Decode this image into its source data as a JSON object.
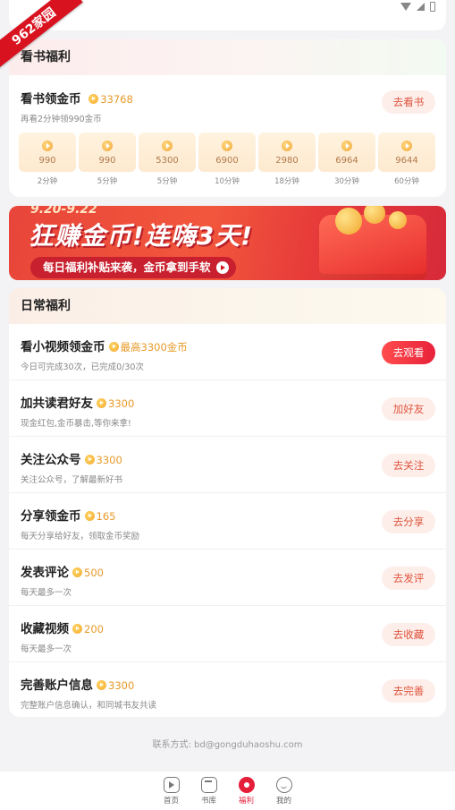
{
  "ribbon_text": "962家园",
  "reading": {
    "header": "看书福利",
    "task_title": "看书领金币",
    "reward": "33768",
    "desc": "再看2分钟领990金币",
    "button": "去看书",
    "slots": [
      {
        "amount": "990",
        "time": "2分钟"
      },
      {
        "amount": "990",
        "time": "5分钟"
      },
      {
        "amount": "5300",
        "time": "5分钟"
      },
      {
        "amount": "6900",
        "time": "10分钟"
      },
      {
        "amount": "2980",
        "time": "18分钟"
      },
      {
        "amount": "6964",
        "time": "30分钟"
      },
      {
        "amount": "9644",
        "time": "60分钟"
      }
    ]
  },
  "banner": {
    "date": "9.20-9.22",
    "title": "狂赚金币!连嗨3天!",
    "subtitle": "每日福利补贴来袭，金币拿到手软"
  },
  "daily": {
    "header": "日常福利",
    "tasks": [
      {
        "title": "看小视频领金币",
        "reward": "最高3300金币",
        "desc": "今日可完成30次，已完成0/30次",
        "button": "去观看"
      },
      {
        "title": "加共读君好友",
        "reward": "3300",
        "desc": "现金红包,金币暴击,等你来拿!",
        "button": "加好友"
      },
      {
        "title": "关注公众号",
        "reward": "3300",
        "desc": "关注公众号，了解最新好书",
        "button": "去关注"
      },
      {
        "title": "分享领金币",
        "reward": "165",
        "desc": "每天分享给好友，领取金币奖励",
        "button": "去分享"
      },
      {
        "title": "发表评论",
        "reward": "500",
        "desc": "每天最多一次",
        "button": "去发评"
      },
      {
        "title": "收藏视频",
        "reward": "200",
        "desc": "每天最多一次",
        "button": "去收藏"
      },
      {
        "title": "完善账户信息",
        "reward": "3300",
        "desc": "完整账户信息确认，和同城书友共读",
        "button": "去完善"
      }
    ]
  },
  "contact": "联系方式: bd@gongduhaoshu.com",
  "tabs": [
    {
      "label": "首页",
      "icon": "play-icon"
    },
    {
      "label": "书库",
      "icon": "book-icon"
    },
    {
      "label": "福利",
      "icon": "welfare-icon"
    },
    {
      "label": "我的",
      "icon": "profile-icon"
    }
  ],
  "active_tab": "福利",
  "colors": {
    "accent": "#e51e3a",
    "coin": "#e79a2a",
    "button_bg": "#fdeeea"
  }
}
